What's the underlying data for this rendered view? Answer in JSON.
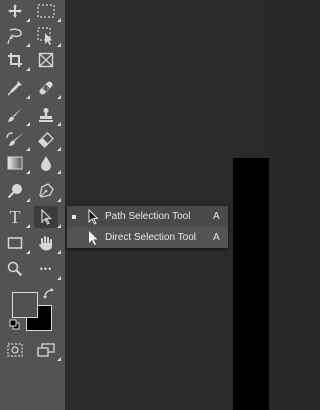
{
  "toolbar": {
    "tools": [
      {
        "name": "move-tool"
      },
      {
        "name": "marquee-tool"
      },
      {
        "name": "lasso-tool"
      },
      {
        "name": "quick-selection-tool"
      },
      {
        "name": "crop-tool"
      },
      {
        "name": "frame-tool"
      },
      {
        "name": "eyedropper-tool"
      },
      {
        "name": "healing-brush-tool"
      },
      {
        "name": "brush-tool"
      },
      {
        "name": "clone-stamp-tool"
      },
      {
        "name": "history-brush-tool"
      },
      {
        "name": "eraser-tool"
      },
      {
        "name": "gradient-tool"
      },
      {
        "name": "blur-tool"
      },
      {
        "name": "dodge-tool"
      },
      {
        "name": "pen-tool"
      },
      {
        "name": "type-tool"
      },
      {
        "name": "path-selection-tool"
      },
      {
        "name": "rectangle-tool"
      },
      {
        "name": "hand-tool"
      },
      {
        "name": "zoom-tool"
      },
      {
        "name": "edit-toolbar"
      },
      {
        "name": "quick-mask-mode"
      },
      {
        "name": "screen-mode"
      }
    ],
    "type_tool_glyph": "T",
    "more_glyph": "•••",
    "foreground_color": "#505050",
    "background_color": "#000000"
  },
  "flyout": {
    "items": [
      {
        "label": "Path Selection Tool",
        "shortcut": "A",
        "icon": "path-selection-arrow-icon",
        "active": true
      },
      {
        "label": "Direct Selection Tool",
        "shortcut": "A",
        "icon": "direct-selection-arrow-icon",
        "active": false
      }
    ]
  },
  "colors": {
    "toolbar_bg": "#535353",
    "canvas_bg": "#282828",
    "document_bg": "#000000",
    "icon": "#d6d6d6"
  }
}
